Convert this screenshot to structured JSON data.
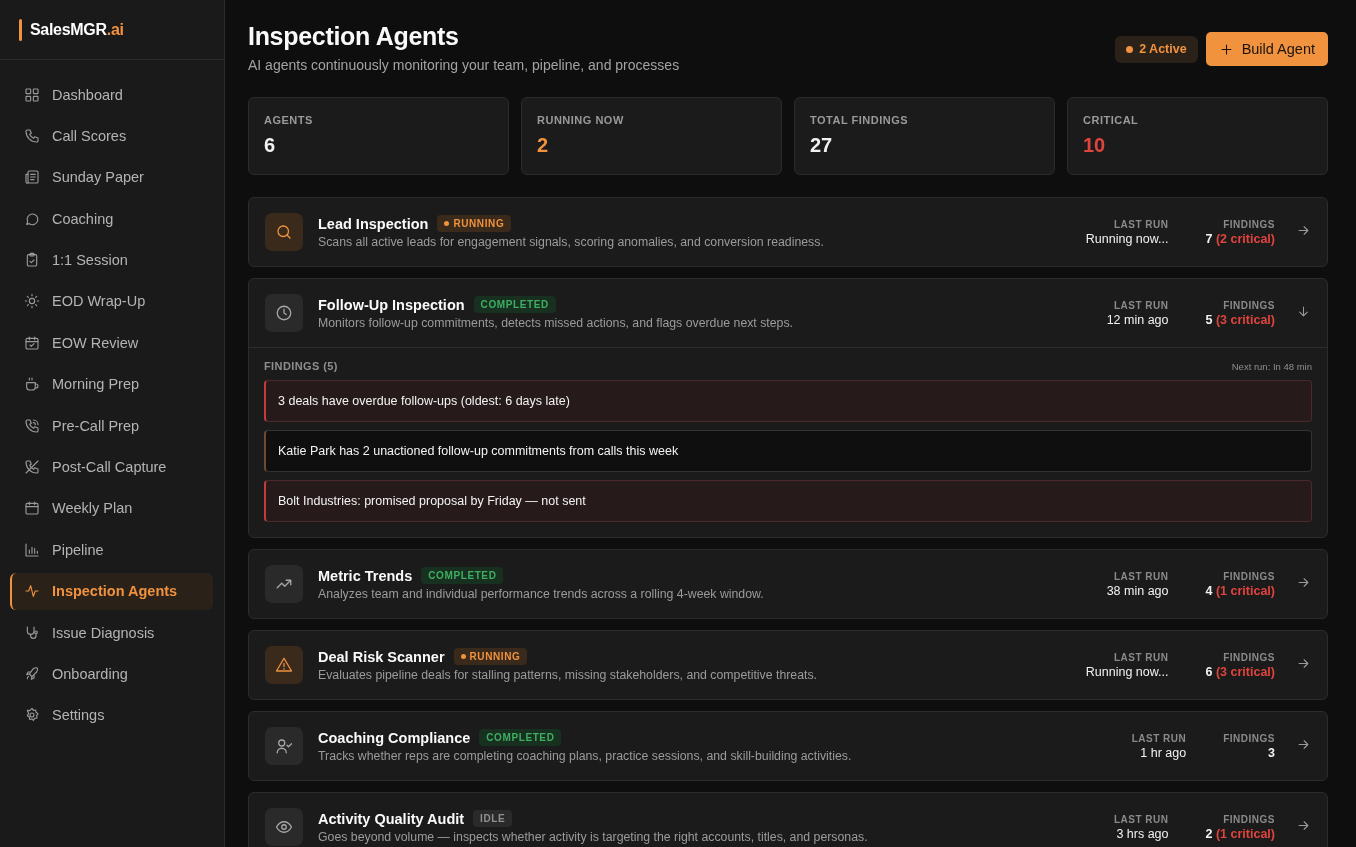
{
  "brand": {
    "name": "SalesMGR",
    "suffix": ".ai"
  },
  "nav": [
    {
      "label": "Dashboard",
      "selected": false
    },
    {
      "label": "Call Scores",
      "selected": false
    },
    {
      "label": "Sunday Paper",
      "selected": false
    },
    {
      "label": "Coaching",
      "selected": false
    },
    {
      "label": "1:1 Session",
      "selected": false
    },
    {
      "label": "EOD Wrap-Up",
      "selected": false
    },
    {
      "label": "EOW Review",
      "selected": false
    },
    {
      "label": "Morning Prep",
      "selected": false
    },
    {
      "label": "Pre-Call Prep",
      "selected": false
    },
    {
      "label": "Post-Call Capture",
      "selected": false
    },
    {
      "label": "Weekly Plan",
      "selected": false
    },
    {
      "label": "Pipeline",
      "selected": false
    },
    {
      "label": "Inspection Agents",
      "selected": true
    },
    {
      "label": "Issue Diagnosis",
      "selected": false
    },
    {
      "label": "Onboarding",
      "selected": false
    },
    {
      "label": "Settings",
      "selected": false
    }
  ],
  "header": {
    "title": "Inspection Agents",
    "subtitle": "AI agents continuously monitoring your team, pipeline, and processes",
    "active_badge": "2 Active",
    "build_button": "Build Agent"
  },
  "stats": [
    {
      "label": "AGENTS",
      "value": "6",
      "color": "#f2f2f2"
    },
    {
      "label": "RUNNING NOW",
      "value": "2",
      "color": "#f0923e"
    },
    {
      "label": "TOTAL FINDINGS",
      "value": "27",
      "color": "#f2f2f2"
    },
    {
      "label": "CRITICAL",
      "value": "10",
      "color": "#e0443e"
    }
  ],
  "agents": [
    {
      "name": "Lead Inspection",
      "status": {
        "label": "RUNNING",
        "kind": "running"
      },
      "description": "Scans all active leads for engagement signals, scoring anomalies, and conversion readiness.",
      "last_run_label": "LAST RUN",
      "last_run": "Running now...",
      "findings_label": "FINDINGS",
      "findings_count": "7",
      "findings_critical": "(2 critical)",
      "expanded": false
    },
    {
      "name": "Follow-Up Inspection",
      "status": {
        "label": "COMPLETED",
        "kind": "completed"
      },
      "description": "Monitors follow-up commitments, detects missed actions, and flags overdue next steps.",
      "last_run_label": "LAST RUN",
      "last_run": "12 min ago",
      "findings_label": "FINDINGS",
      "findings_count": "5",
      "findings_critical": "(3 critical)",
      "expanded": true,
      "findings": {
        "title": "FINDINGS (5)",
        "next_run": "Next run: In 48 min",
        "items": [
          {
            "text": "3 deals have overdue follow-ups (oldest: 6 days late)",
            "critical": true
          },
          {
            "text": "Katie Park has 2 unactioned follow-up commitments from calls this week",
            "critical": false
          },
          {
            "text": "Bolt Industries: promised proposal by Friday — not sent",
            "critical": true
          }
        ]
      }
    },
    {
      "name": "Metric Trends",
      "status": {
        "label": "COMPLETED",
        "kind": "completed"
      },
      "description": "Analyzes team and individual performance trends across a rolling 4-week window.",
      "last_run_label": "LAST RUN",
      "last_run": "38 min ago",
      "findings_label": "FINDINGS",
      "findings_count": "4",
      "findings_critical": "(1 critical)",
      "expanded": false
    },
    {
      "name": "Deal Risk Scanner",
      "status": {
        "label": "RUNNING",
        "kind": "running"
      },
      "description": "Evaluates pipeline deals for stalling patterns, missing stakeholders, and competitive threats.",
      "last_run_label": "LAST RUN",
      "last_run": "Running now...",
      "findings_label": "FINDINGS",
      "findings_count": "6",
      "findings_critical": "(3 critical)",
      "expanded": false
    },
    {
      "name": "Coaching Compliance",
      "status": {
        "label": "COMPLETED",
        "kind": "completed"
      },
      "description": "Tracks whether reps are completing coaching plans, practice sessions, and skill-building activities.",
      "last_run_label": "LAST RUN",
      "last_run": "1 hr ago",
      "findings_label": "FINDINGS",
      "findings_count": "3",
      "expanded": false
    },
    {
      "name": "Activity Quality Audit",
      "status": {
        "label": "IDLE",
        "kind": "idle"
      },
      "description": "Goes beyond volume — inspects whether activity is targeting the right accounts, titles, and personas.",
      "last_run_label": "LAST RUN",
      "last_run": "3 hrs ago",
      "findings_label": "FINDINGS",
      "findings_count": "2",
      "findings_critical": "(1 critical)",
      "expanded": false
    }
  ]
}
